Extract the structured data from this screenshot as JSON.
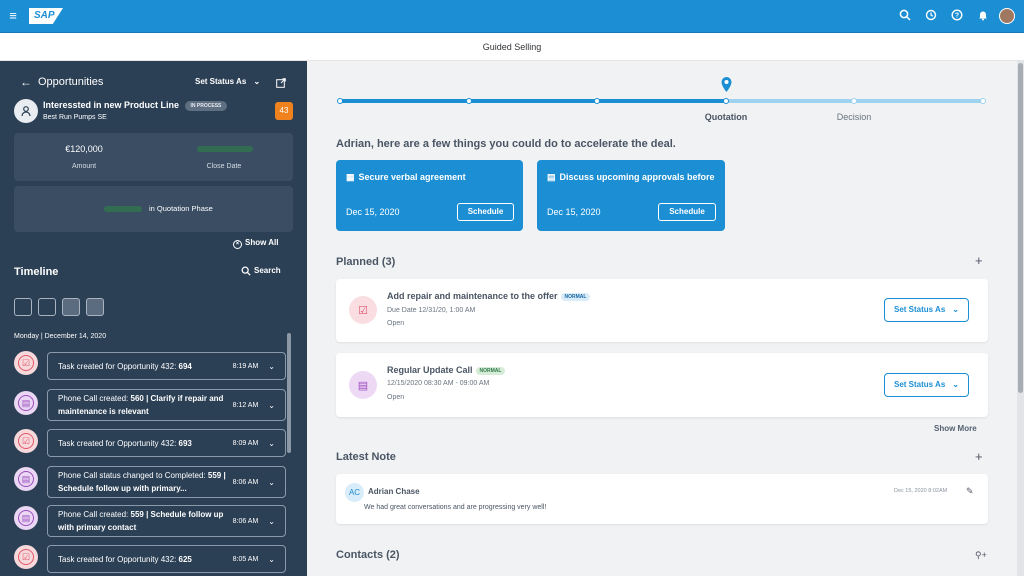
{
  "shell": {
    "logo": "SAP"
  },
  "header": {
    "subtitle": "Guided Selling"
  },
  "sidebar": {
    "back_title": "Opportunities",
    "set_status": "Set Status As",
    "opp_title": "Interessted in new Product Line",
    "status_badge": "IN PROCESS",
    "company": "Best Run Pumps SE",
    "count": "43",
    "amount": "€120,000",
    "amount_label": "Amount",
    "close_date_label": "Close Date",
    "phase_text": "in Quotation Phase",
    "show_all": "Show All",
    "timeline_title": "Timeline",
    "search": "Search",
    "date_header": "Monday | December 14, 2020",
    "items": [
      {
        "text": "Task created for Opportunity 432: ",
        "bold": "694",
        "time": "8:19 AM"
      },
      {
        "text": "Phone Call created: ",
        "bold": "560 | Clarify if repair and maintenance is relevant",
        "time": "8:12 AM"
      },
      {
        "text": "Task created for Opportunity 432: ",
        "bold": "693",
        "time": "8:09 AM"
      },
      {
        "text": "Phone Call status changed to Completed: ",
        "bold": "559 | Schedule follow up with primary...",
        "time": "8:06 AM"
      },
      {
        "text": "Phone Call created: ",
        "bold": "559 | Schedule follow up with primary contact",
        "time": "8:06 AM"
      },
      {
        "text": "Task created for Opportunity 432: ",
        "bold": "625",
        "time": "8:05 AM"
      }
    ]
  },
  "progress": {
    "current": "Quotation",
    "next": "Decision"
  },
  "main": {
    "headline": "Adrian, here are a few things you could do to accelerate the deal.",
    "actions": [
      {
        "title": "Secure verbal agreement",
        "date": "Dec 15, 2020",
        "button": "Schedule"
      },
      {
        "title": "Discuss upcoming approvals before",
        "date": "Dec 15, 2020",
        "button": "Schedule"
      }
    ],
    "planned_title": "Planned (3)",
    "planned": [
      {
        "title": "Add repair and maintenance to the offer",
        "badge": "NORMAL",
        "line1": "Due Date 12/31/20, 1:00 AM",
        "line2": "Open",
        "button": "Set Status As"
      },
      {
        "title": "Regular Update Call",
        "badge": "NORMAL",
        "line1": "12/15/2020 08:30 AM - 09:00 AM",
        "line2": "Open",
        "button": "Set Status As"
      }
    ],
    "show_more": "Show More",
    "note_title": "Latest Note",
    "note": {
      "initials": "AC",
      "author": "Adrian Chase",
      "date": "Dec 15, 2020 8:02AM",
      "text": "We had great conversations and are progressing very well!"
    },
    "contacts_title": "Contacts (2)"
  },
  "colors": {
    "shell": "#1c8fd4",
    "sidebar": "#2b3f55",
    "accent": "#1c8fd4",
    "count_badge": "#f0821e"
  }
}
